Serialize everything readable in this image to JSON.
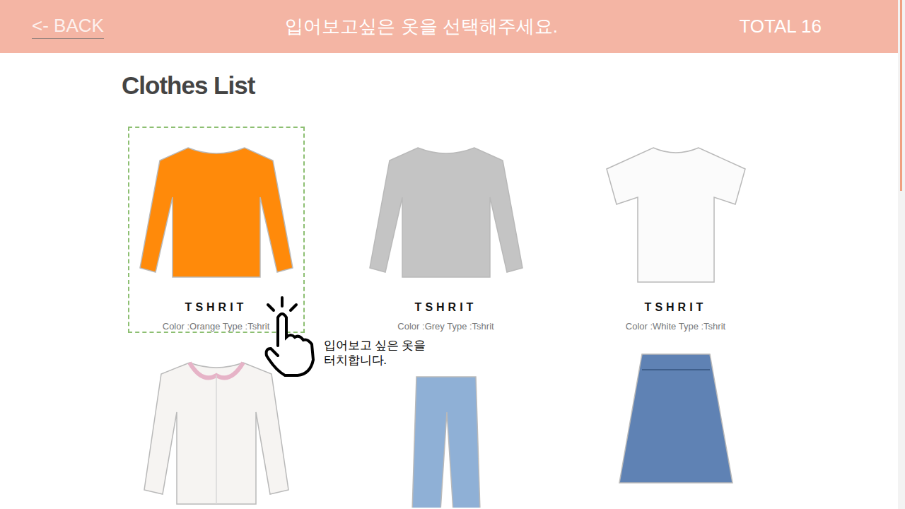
{
  "header": {
    "back": "<- BACK",
    "title": "입어보고싶은 옷을 선택해주세요.",
    "total": "TOTAL 16"
  },
  "page_title": "Clothes List",
  "items": [
    {
      "title": "TSHRIT",
      "caption": "Color :Orange Type :Tshrit",
      "kind": "sweatshirt",
      "color": "#ff8a0a",
      "selected": true
    },
    {
      "title": "TSHRIT",
      "caption": "Color :Grey Type :Tshrit",
      "kind": "sweatshirt",
      "color": "#c4c4c4",
      "selected": false
    },
    {
      "title": "TSHRIT",
      "caption": "Color :White Type :Tshrit",
      "kind": "tee",
      "color": "#fbfbfb",
      "selected": false
    },
    {
      "kind": "cardigan",
      "color": "#f6f4f2",
      "selected": false
    },
    {
      "kind": "jeans",
      "color": "#8fb0d6",
      "selected": false
    },
    {
      "kind": "skirt",
      "color": "#5f82b4",
      "selected": false
    }
  ],
  "hint": {
    "text": "입어보고 싶은 옷을\n터치합니다."
  }
}
